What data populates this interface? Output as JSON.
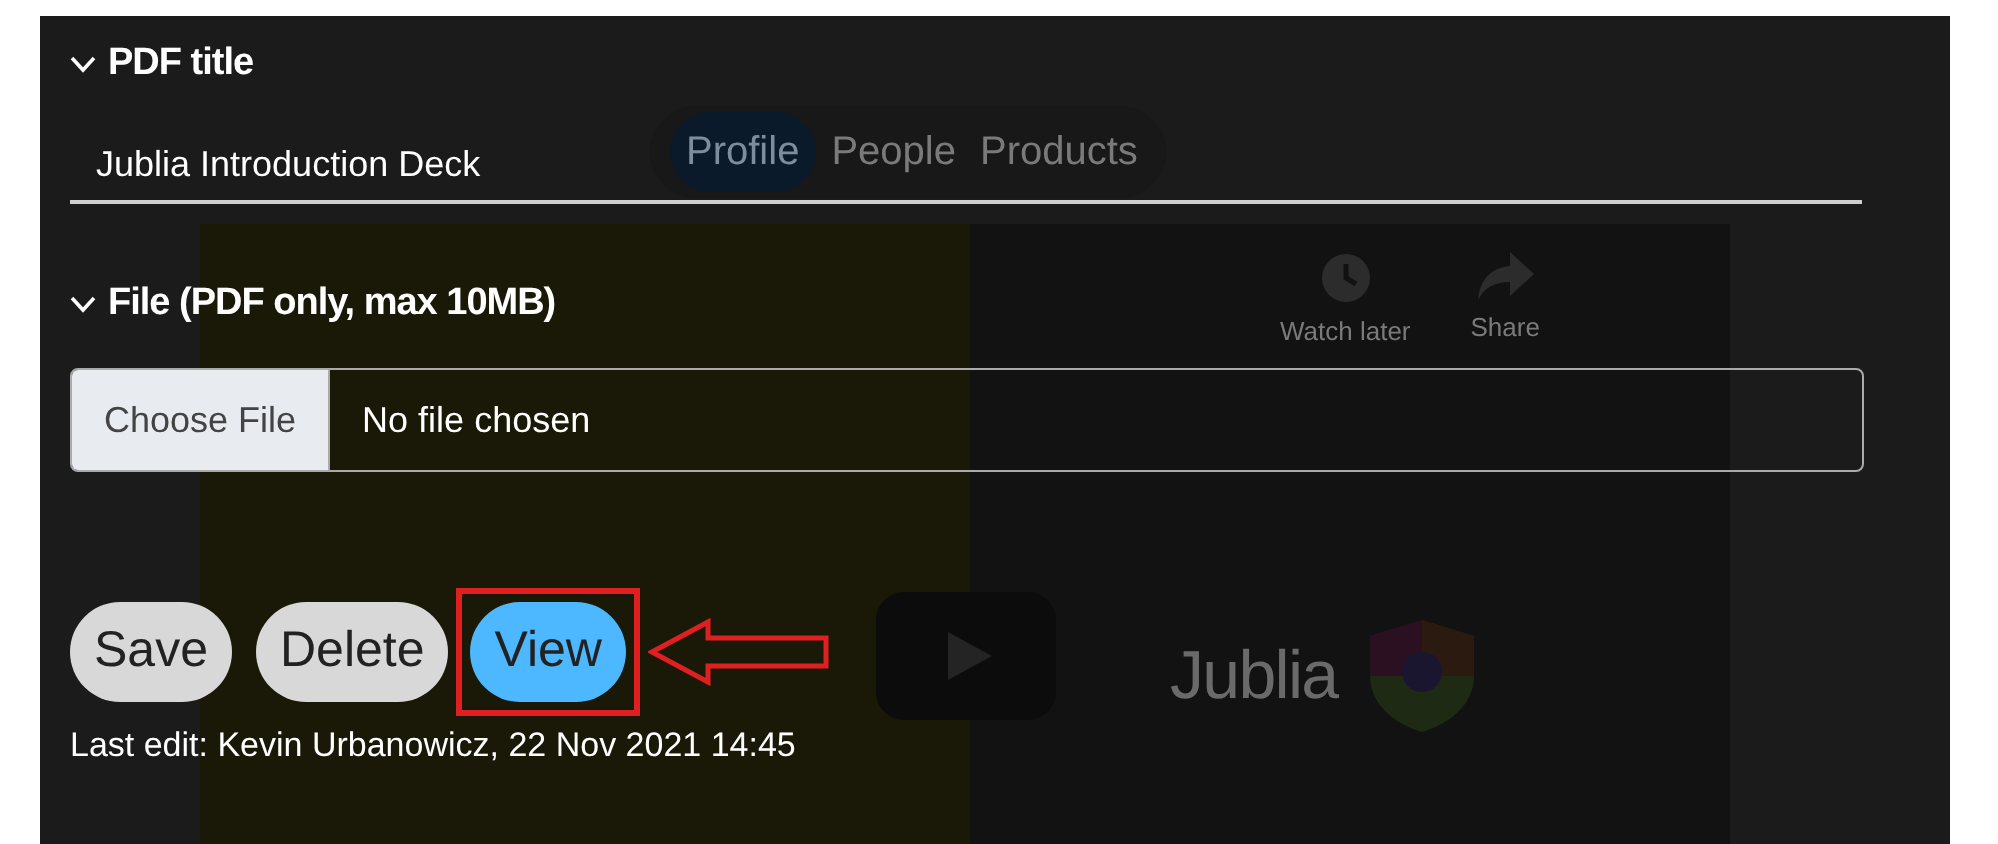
{
  "background_page": {
    "tabs": [
      {
        "label": "Profile",
        "selected": true
      },
      {
        "label": "People",
        "selected": false
      },
      {
        "label": "Products",
        "selected": false
      }
    ],
    "video_actions": [
      {
        "kind": "clock",
        "label": "Watch later"
      },
      {
        "kind": "share",
        "label": "Share"
      }
    ],
    "logo": "Jublia"
  },
  "sections": [
    {
      "title": "PDF title",
      "expanded": true,
      "kind": "text",
      "value": "Jublia Introduction Deck"
    },
    {
      "title": "File (PDF only, max 10MB)",
      "expanded": true,
      "kind": "file",
      "button": "Choose File",
      "value": "No file chosen"
    }
  ],
  "buttons": [
    {
      "label": "Save",
      "kind": "default"
    },
    {
      "label": "Delete",
      "kind": "default"
    },
    {
      "label": "View",
      "kind": "primary",
      "highlighted": true
    }
  ],
  "last_edit": "Last edit: Kevin Urbanowicz, 22 Nov 2021 14:45"
}
